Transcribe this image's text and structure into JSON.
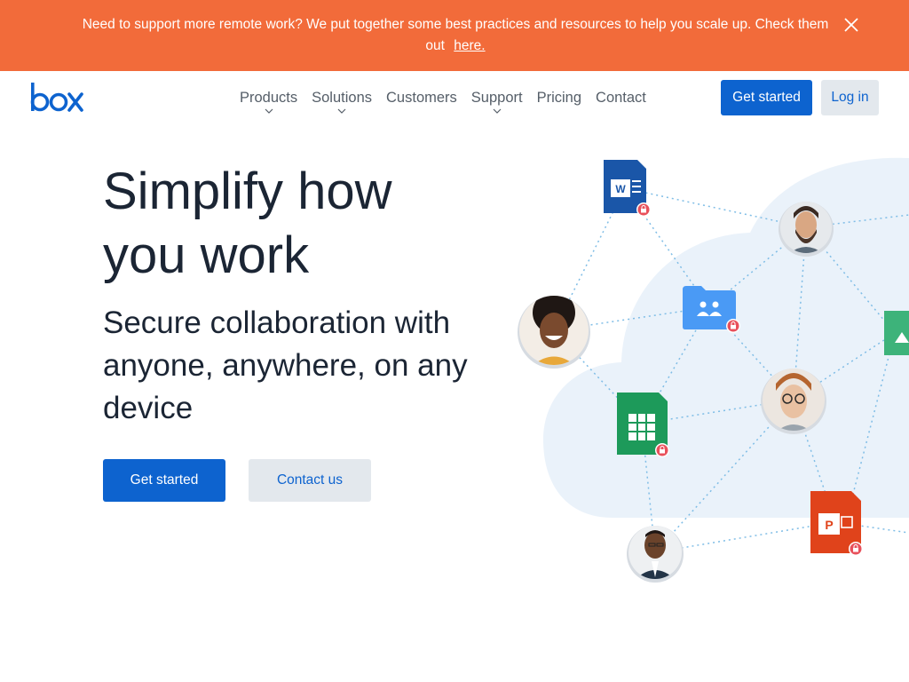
{
  "banner": {
    "message": "Need to support more remote work? We put together some best practices and resources to help you scale up. Check them out",
    "link_text": "here.",
    "close_icon": "close-icon",
    "color": "#f26b3a"
  },
  "nav": {
    "logo_text": "box",
    "items": [
      {
        "label": "Products",
        "has_dropdown": true
      },
      {
        "label": "Solutions",
        "has_dropdown": true
      },
      {
        "label": "Customers",
        "has_dropdown": false
      },
      {
        "label": "Support",
        "has_dropdown": true
      },
      {
        "label": "Pricing",
        "has_dropdown": false
      },
      {
        "label": "Contact",
        "has_dropdown": false
      }
    ],
    "get_started": "Get started",
    "login": "Log in"
  },
  "hero": {
    "title": "Simplify how you work",
    "subtitle": "Secure collaboration with anyone, anywhere, on any device",
    "primary_button": "Get started",
    "secondary_button": "Contact us"
  },
  "illustration": {
    "file_icons": [
      "word-doc-icon",
      "shared-folder-icon",
      "spreadsheet-icon",
      "powerpoint-icon",
      "image-file-icon"
    ],
    "avatars": [
      "avatar-man-beard",
      "avatar-woman-smiling",
      "avatar-man-glasses",
      "avatar-man-suit"
    ],
    "lock_badge_icon": "lock-icon"
  },
  "colors": {
    "brand_blue": "#0d63cf",
    "banner_orange": "#f26b3a",
    "heading": "#1b2534",
    "secondary_button_bg": "#e3e8ed"
  }
}
